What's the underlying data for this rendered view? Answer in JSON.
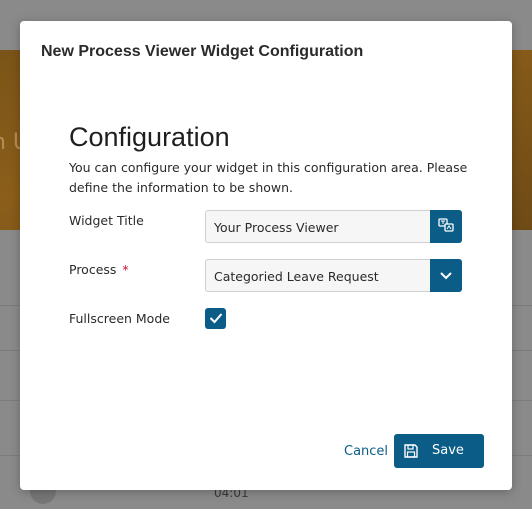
{
  "background": {
    "banner_text": "n U",
    "time_text": "04:01"
  },
  "dialog": {
    "title": "New Process Viewer Widget Configuration",
    "heading": "Configuration",
    "description": "You can configure your widget in this configuration area. Please define the information to be shown.",
    "fields": {
      "widget_title": {
        "label": "Widget Title",
        "value": "Your Process Viewer",
        "button_icon": "translate-icon"
      },
      "process": {
        "label": "Process",
        "required_mark": "*",
        "value": "Categoried Leave Request",
        "button_icon": "chevron-down-icon"
      },
      "fullscreen": {
        "label": "Fullscreen Mode",
        "checked": true
      }
    },
    "actions": {
      "cancel": "Cancel",
      "save": "Save",
      "save_icon": "save-icon"
    }
  },
  "colors": {
    "accent": "#0b5d88",
    "required": "#c8102e"
  }
}
